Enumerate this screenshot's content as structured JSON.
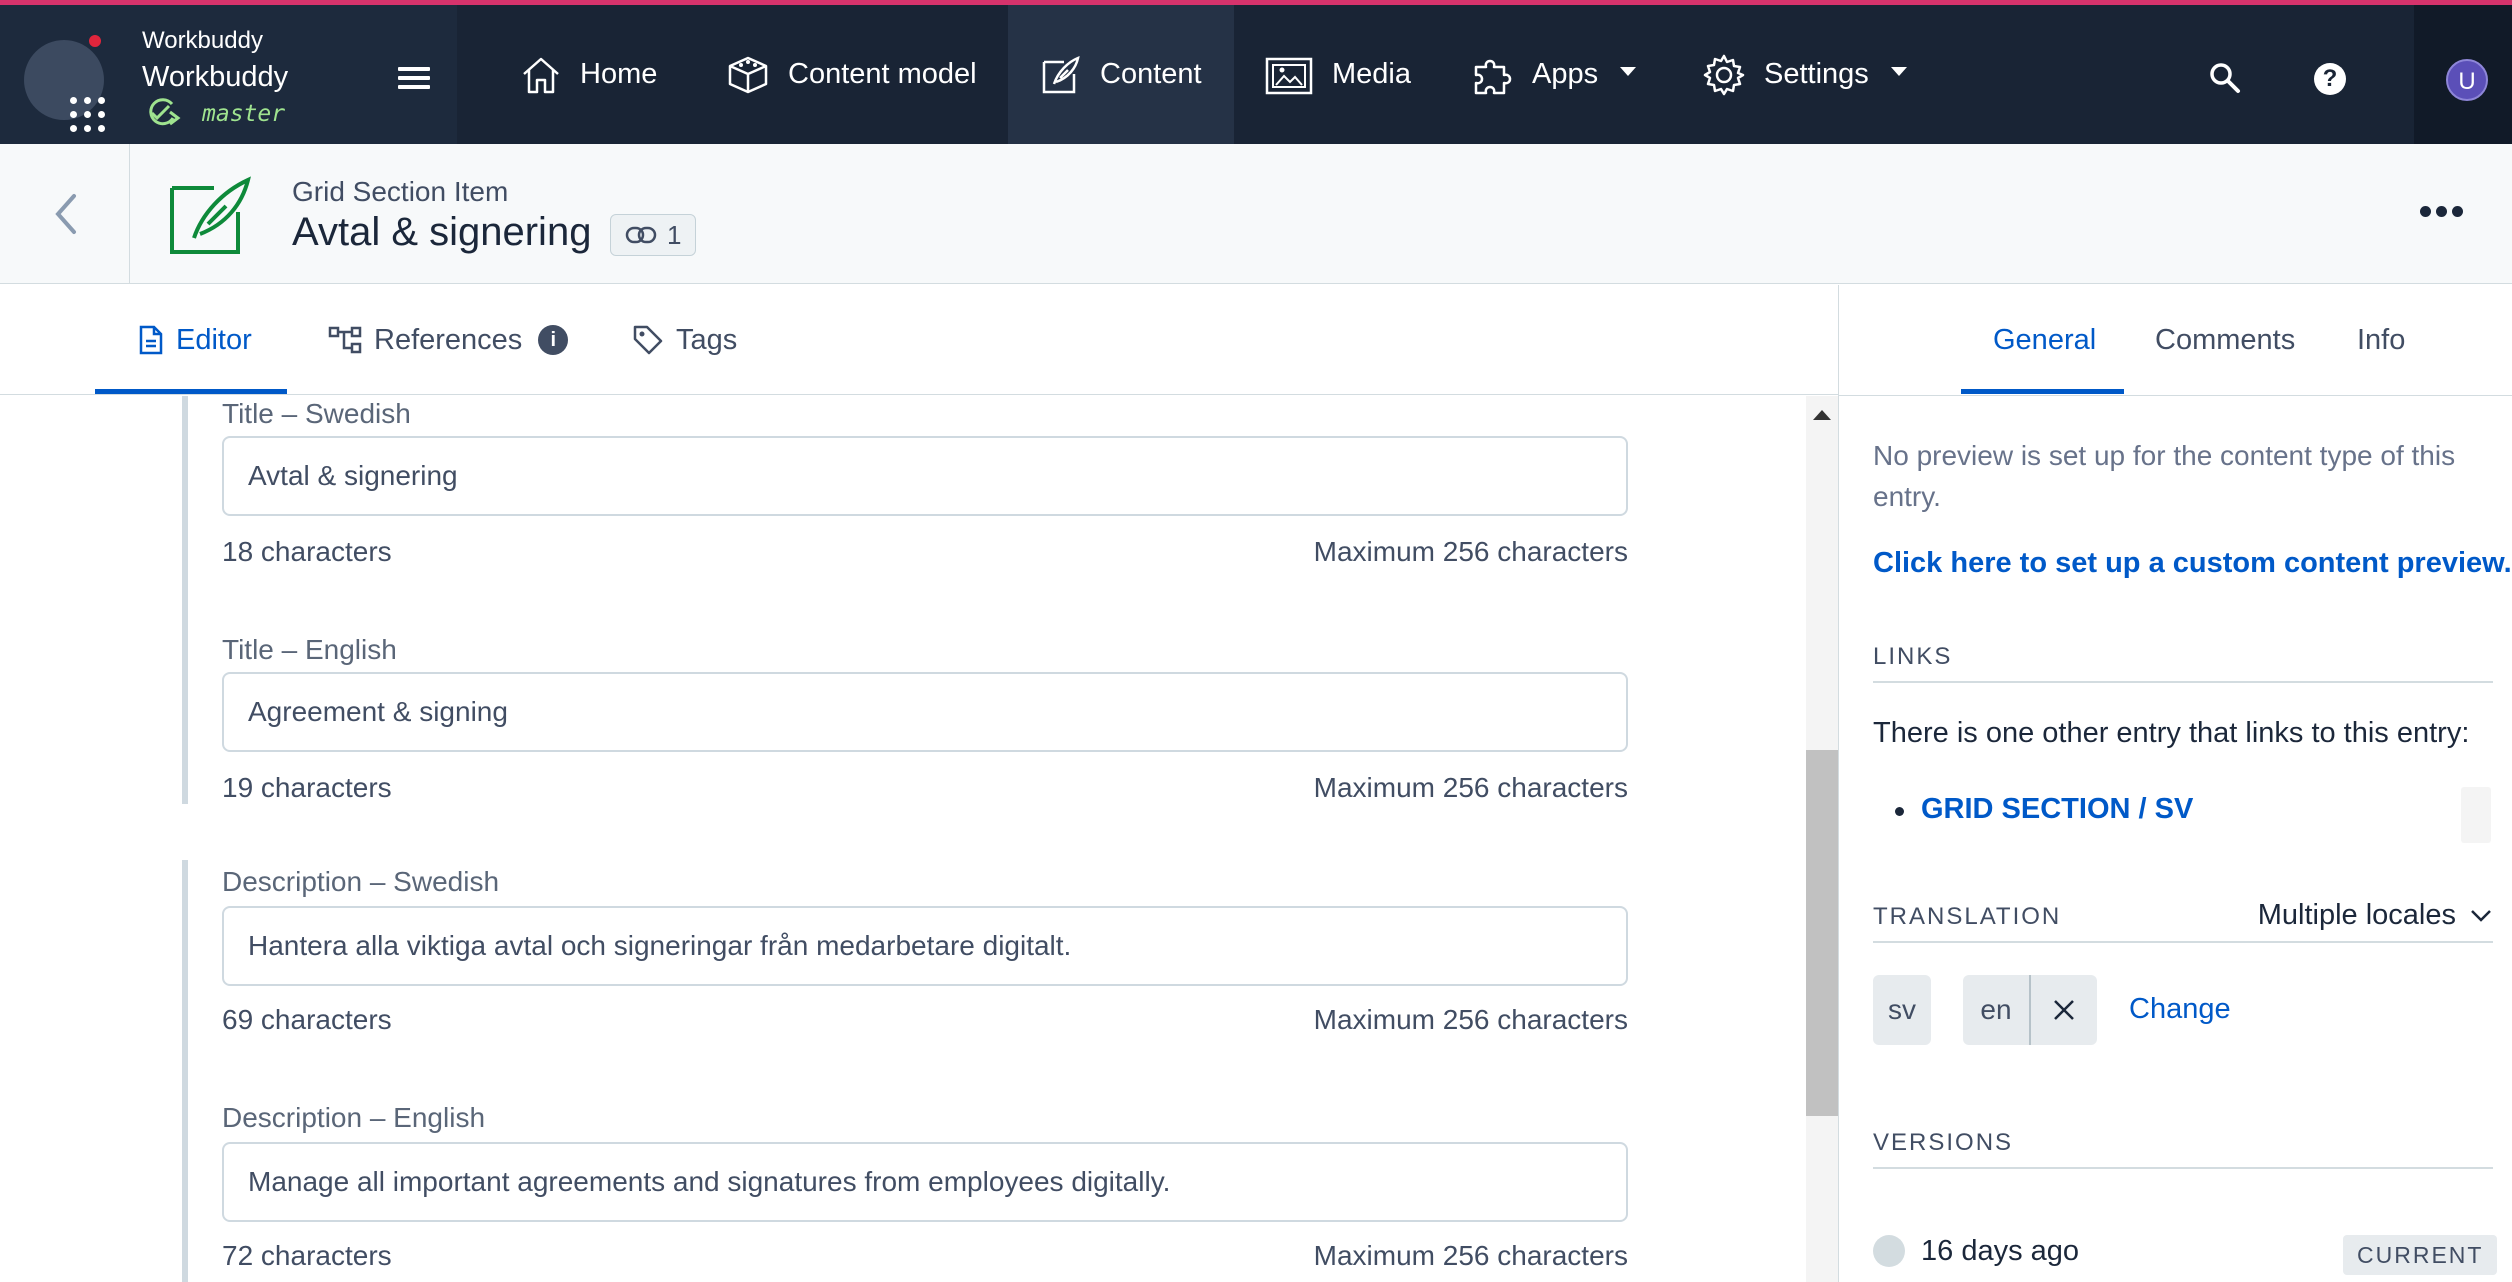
{
  "topnav": {
    "org_name": "Workbuddy",
    "space_name": "Workbuddy",
    "environment": "master",
    "items": [
      {
        "label": "Home",
        "icon": "home-icon"
      },
      {
        "label": "Content model",
        "icon": "content-model-icon"
      },
      {
        "label": "Content",
        "icon": "content-icon",
        "active": true
      },
      {
        "label": "Media",
        "icon": "media-icon"
      },
      {
        "label": "Apps",
        "icon": "apps-puzzle-icon"
      },
      {
        "label": "Settings",
        "icon": "gear-icon"
      }
    ],
    "help_glyph": "?",
    "avatar_initial": "U",
    "accent_color": "#d6336c",
    "background_color": "#192435"
  },
  "entry": {
    "content_type": "Grid Section Item",
    "title": "Avtal & signering",
    "link_count": "1"
  },
  "editor_tabs": [
    {
      "label": "Editor",
      "active": true
    },
    {
      "label": "References",
      "info": "i"
    },
    {
      "label": "Tags"
    }
  ],
  "fields": [
    {
      "label": "Title – Swedish",
      "value": "Avtal & signering",
      "count": "18 characters",
      "max": "Maximum 256 characters"
    },
    {
      "label": "Title – English",
      "value": "Agreement & signing",
      "count": "19 characters",
      "max": "Maximum 256 characters"
    },
    {
      "label": "Description – Swedish",
      "value": "Hantera alla viktiga avtal och signeringar från medarbetare digitalt.",
      "count": "69 characters",
      "max": "Maximum 256 characters"
    },
    {
      "label": "Description – English",
      "value": "Manage all important agreements and signatures from employees digitally.",
      "count": "72 characters",
      "max": "Maximum 256 characters"
    }
  ],
  "sidebar": {
    "tabs": [
      {
        "label": "General",
        "active": true
      },
      {
        "label": "Comments"
      },
      {
        "label": "Info"
      }
    ],
    "preview_text": "No preview is set up for the content type of this entry.",
    "preview_link": "Click here to set up a custom content preview.",
    "links_heading": "LINKS",
    "links_text": "There is one other entry that links to this entry:",
    "links_items": [
      "GRID SECTION / SV"
    ],
    "translation_heading": "TRANSLATION",
    "translation_select": "Multiple locales",
    "locales": [
      "sv",
      "en"
    ],
    "change_label": "Change",
    "versions_heading": "VERSIONS",
    "version_time": "16 days ago",
    "version_badge": "CURRENT",
    "link_color": "#0059c8"
  }
}
